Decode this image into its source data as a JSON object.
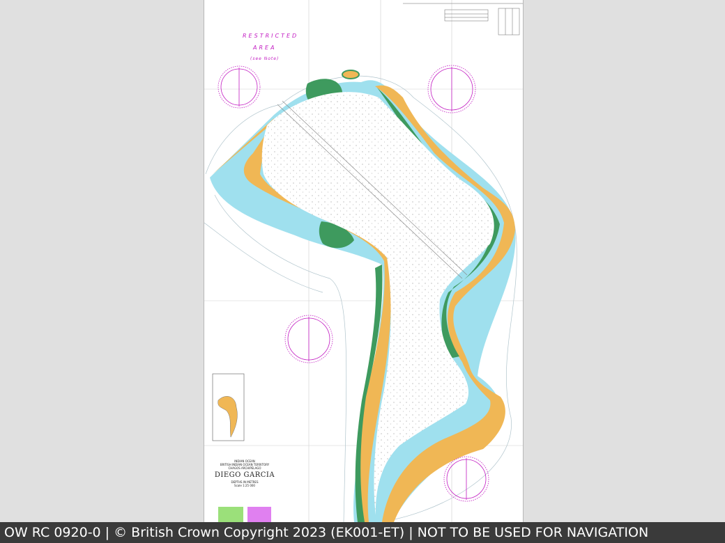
{
  "chart": {
    "restricted_line1": "RESTRICTED",
    "restricted_line2": "AREA",
    "restricted_line3": "(see Note)",
    "title_small_1": "INDIAN OCEAN",
    "title_small_2": "BRITISH INDIAN OCEAN TERRITORY",
    "title_small_3": "CHAGOS ARCHIPELAGO",
    "title": "DIEGO GARCIA",
    "subtitle": "DEPTHS IN METRES",
    "scale": "Scale 1:25 000"
  },
  "colors": {
    "land": "#f0b755",
    "vegetation": "#3e9a5e",
    "shallow_water": "#9fe0ee",
    "deep_water": "#ffffff",
    "magenta": "#c21ac2",
    "background": "#e0e0e0"
  },
  "footer": {
    "text": "OW RC 0920-0 | © British Crown Copyright 2023 (EK001-ET) | NOT TO BE USED FOR NAVIGATION"
  }
}
